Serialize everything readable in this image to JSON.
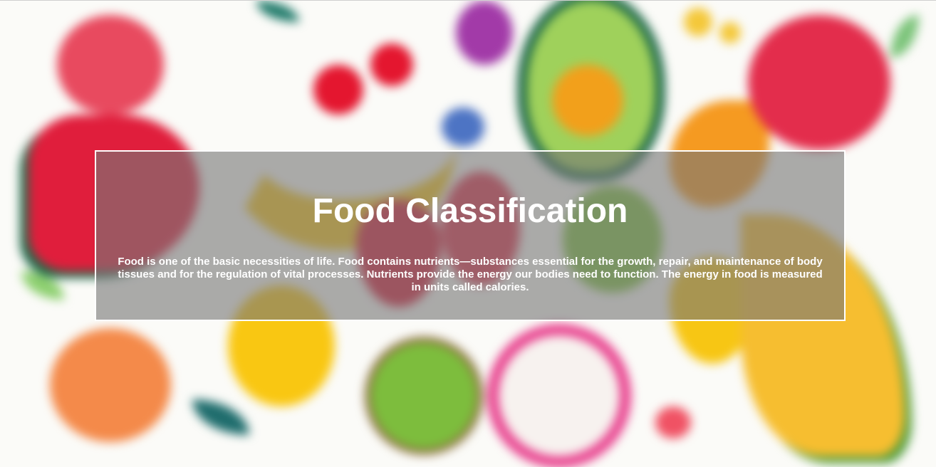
{
  "hero": {
    "title": "Food Classification",
    "description": "Food is one of the basic necessities of life. Food contains nutrients—substances essential for the growth, repair, and maintenance of body tissues and for the regulation of vital processes. Nutrients provide the energy our bodies need to function. The energy in food is measured in units called calories."
  },
  "background": {
    "fruits": [
      "pomegranate",
      "watermelon",
      "banana",
      "cherry",
      "plum",
      "blueberry",
      "avocado",
      "orange",
      "strawberry",
      "green-apple",
      "lemon",
      "kiwi",
      "dragon-fruit",
      "melon",
      "peach",
      "pear",
      "leaf"
    ]
  },
  "colors": {
    "overlay": "#7a7a7a",
    "overlay_border": "#ffffff",
    "text": "#ffffff"
  }
}
